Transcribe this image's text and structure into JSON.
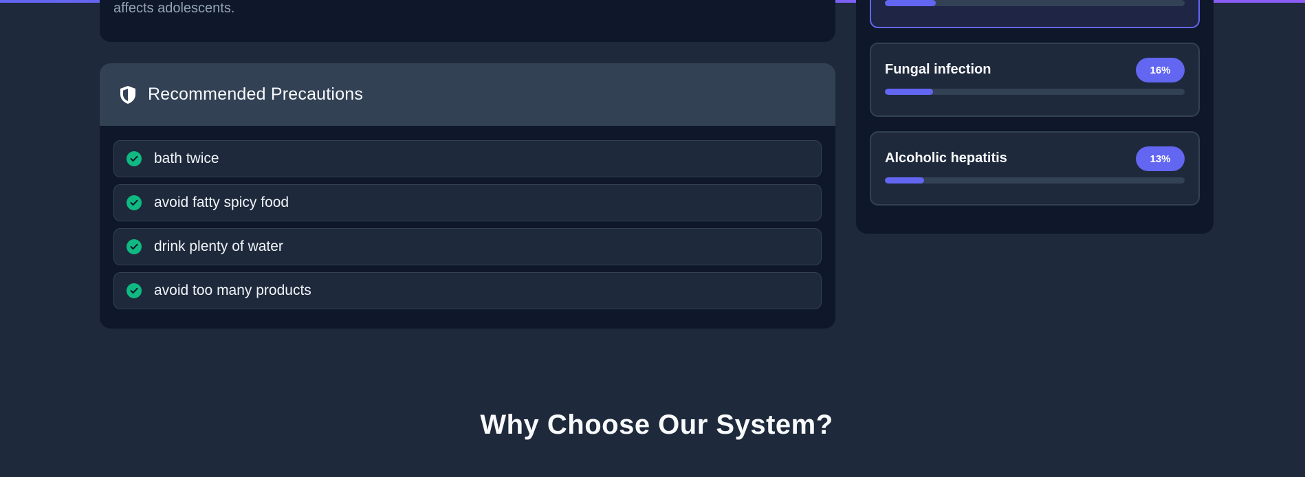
{
  "condition_description": {
    "tail_text": "affects adolescents."
  },
  "precautions": {
    "title": "Recommended Precautions",
    "items": [
      {
        "label": "bath twice"
      },
      {
        "label": "avoid fatty spicy food"
      },
      {
        "label": "drink plenty of water"
      },
      {
        "label": "avoid too many products"
      }
    ]
  },
  "predictions": [
    {
      "name": "",
      "percent_label": "",
      "fraction": 0.17,
      "active": true
    },
    {
      "name": "Fungal infection",
      "percent_label": "16%",
      "fraction": 0.16,
      "active": false
    },
    {
      "name": "Alcoholic hepatitis",
      "percent_label": "13%",
      "fraction": 0.13,
      "active": false
    }
  ],
  "section": {
    "why_title": "Why Choose Our System?"
  },
  "colors": {
    "accent": "#6366f1",
    "success": "#10b981",
    "background": "#1e293b",
    "card": "#0f172a"
  },
  "icons": {
    "precautions_header": "shield-icon",
    "precaution_item": "check-circle-icon"
  }
}
